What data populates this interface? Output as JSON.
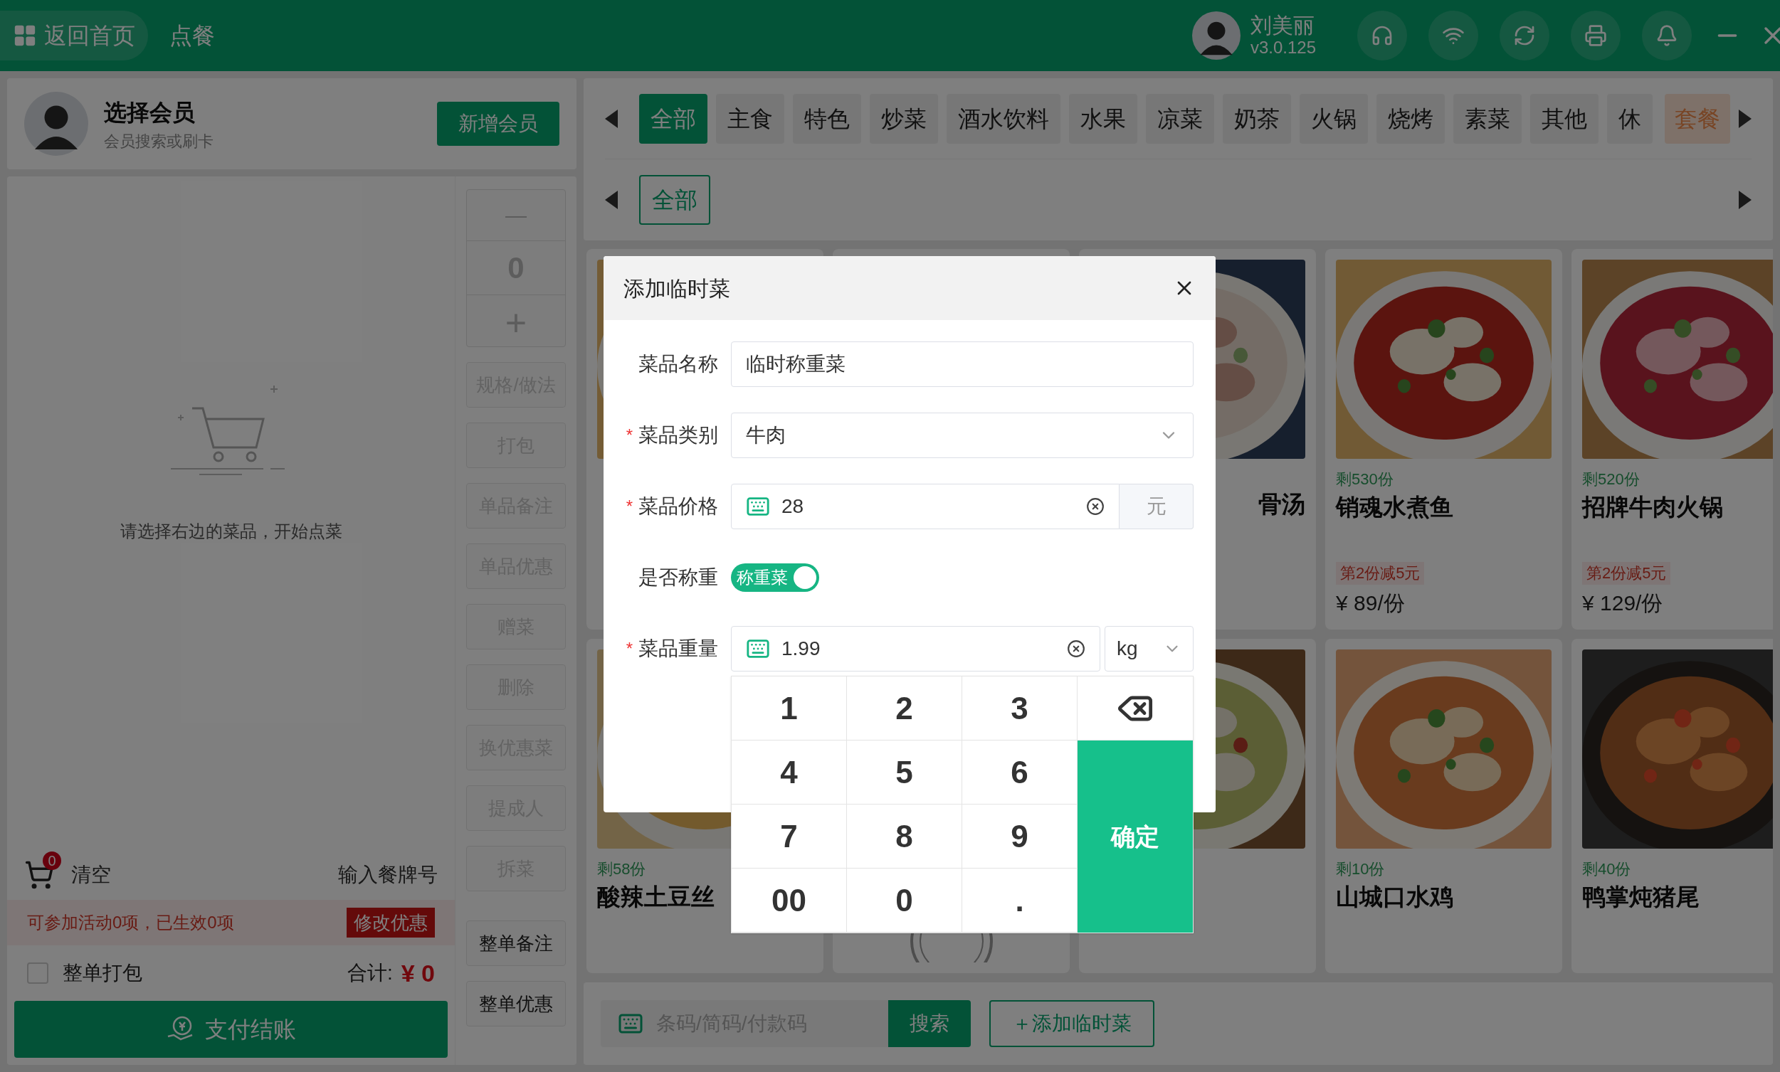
{
  "top_bar": {
    "home_button": "返回首页",
    "page_title": "点餐",
    "user": {
      "name": "刘美丽",
      "version": "v3.0.125"
    }
  },
  "member": {
    "title": "选择会员",
    "hint": "会员搜索或刷卡",
    "add_button": "新增会员"
  },
  "stepper": {
    "minus": "—",
    "count": "0",
    "plus": "+"
  },
  "actions": [
    {
      "label": "规格/做法",
      "disabled": true
    },
    {
      "label": "打包",
      "disabled": true
    },
    {
      "label": "单品备注",
      "disabled": true
    },
    {
      "label": "单品优惠",
      "disabled": true
    },
    {
      "label": "赠菜",
      "disabled": true
    },
    {
      "label": "删除",
      "disabled": true
    },
    {
      "label": "换优惠菜",
      "disabled": true
    },
    {
      "label": "提成人",
      "disabled": true
    },
    {
      "label": "拆菜",
      "disabled": true
    },
    {
      "label": "整单备注",
      "disabled": false
    },
    {
      "label": "整单优惠",
      "disabled": false
    }
  ],
  "cart": {
    "empty_text": "请选择右边的菜品，开始点菜",
    "badge": "0",
    "clear": "清空",
    "table_number": "输入餐牌号",
    "promo_text": "可参加活动0项，已生效0项",
    "promo_button": "修改优惠",
    "pack_all": {
      "label": "整单打包",
      "checked": false
    },
    "total_label": "合计:",
    "total_value": "¥ 0",
    "pay_button": "支付结账"
  },
  "categories": [
    {
      "label": "全部",
      "kind": "category",
      "selected": true
    },
    {
      "label": "主食",
      "kind": "category",
      "selected": false
    },
    {
      "label": "特色",
      "kind": "category",
      "selected": false
    },
    {
      "label": "炒菜",
      "kind": "category",
      "selected": false
    },
    {
      "label": "酒水饮料",
      "kind": "category",
      "selected": false
    },
    {
      "label": "水果",
      "kind": "category",
      "selected": false
    },
    {
      "label": "凉菜",
      "kind": "category",
      "selected": false
    },
    {
      "label": "奶茶",
      "kind": "category",
      "selected": false
    },
    {
      "label": "火锅",
      "kind": "category",
      "selected": false
    },
    {
      "label": "烧烤",
      "kind": "category",
      "selected": false
    },
    {
      "label": "素菜",
      "kind": "category",
      "selected": false
    },
    {
      "label": "其他",
      "kind": "category",
      "selected": false
    },
    {
      "label": "休",
      "kind": "category",
      "selected": false
    },
    {
      "label": "套餐",
      "kind": "set",
      "selected": false
    }
  ],
  "subcategories": [
    {
      "label": "全部",
      "selected": true
    }
  ],
  "dishes": [
    {
      "kind": "full"
    },
    {
      "kind": "covered"
    },
    {
      "kind": "cut",
      "title": "骨汤"
    },
    {
      "kind": "full",
      "stock": "剩530份",
      "title": "销魂水煮鱼",
      "promo": "第2份减5元",
      "price": "¥ 89/份"
    },
    {
      "kind": "full",
      "stock": "剩520份",
      "title": "招牌牛肉火锅",
      "promo": "第2份减5元",
      "price": "¥ 129/份"
    },
    {
      "kind": "full",
      "stock": "剩58份",
      "title": "酸辣土豆丝"
    },
    {
      "kind": "stamp"
    },
    {
      "kind": "full"
    },
    {
      "kind": "full",
      "stock": "剩10份",
      "title": "山城口水鸡"
    },
    {
      "kind": "full",
      "stock": "剩40份",
      "title": "鸭掌炖猪尾"
    }
  ],
  "bottom_bar": {
    "search_placeholder": "条码/简码/付款码",
    "search_button": "搜索",
    "add_temp_button": "＋添加临时菜"
  },
  "dialog": {
    "title": "添加临时菜",
    "fields": [
      {
        "kind": "text",
        "label": "菜品名称",
        "value": "临时称重菜"
      },
      {
        "kind": "select",
        "required_mark": "*",
        "label": "菜品类别",
        "value": "牛肉"
      },
      {
        "kind": "price",
        "required_mark": "*",
        "label": "菜品价格",
        "value": "28",
        "suffix": "元"
      },
      {
        "kind": "switch",
        "label": "是否称重",
        "on": true,
        "switch_text": "称重菜"
      },
      {
        "kind": "weight",
        "required_mark": "*",
        "label": "菜品重量",
        "value": "1.99",
        "unit": "kg"
      }
    ],
    "keypad": [
      {
        "kind": "digit",
        "label": "1"
      },
      {
        "kind": "digit",
        "label": "2"
      },
      {
        "kind": "digit",
        "label": "3"
      },
      {
        "kind": "backspace"
      },
      {
        "kind": "digit",
        "label": "4"
      },
      {
        "kind": "digit",
        "label": "5"
      },
      {
        "kind": "digit",
        "label": "6"
      },
      {
        "kind": "digit",
        "label": "7"
      },
      {
        "kind": "digit",
        "label": "8"
      },
      {
        "kind": "digit",
        "label": "9"
      },
      {
        "kind": "digit",
        "label": "00"
      },
      {
        "kind": "digit",
        "label": "0"
      },
      {
        "kind": "digit",
        "label": "."
      },
      {
        "kind": "confirm",
        "label": "确定"
      }
    ]
  }
}
